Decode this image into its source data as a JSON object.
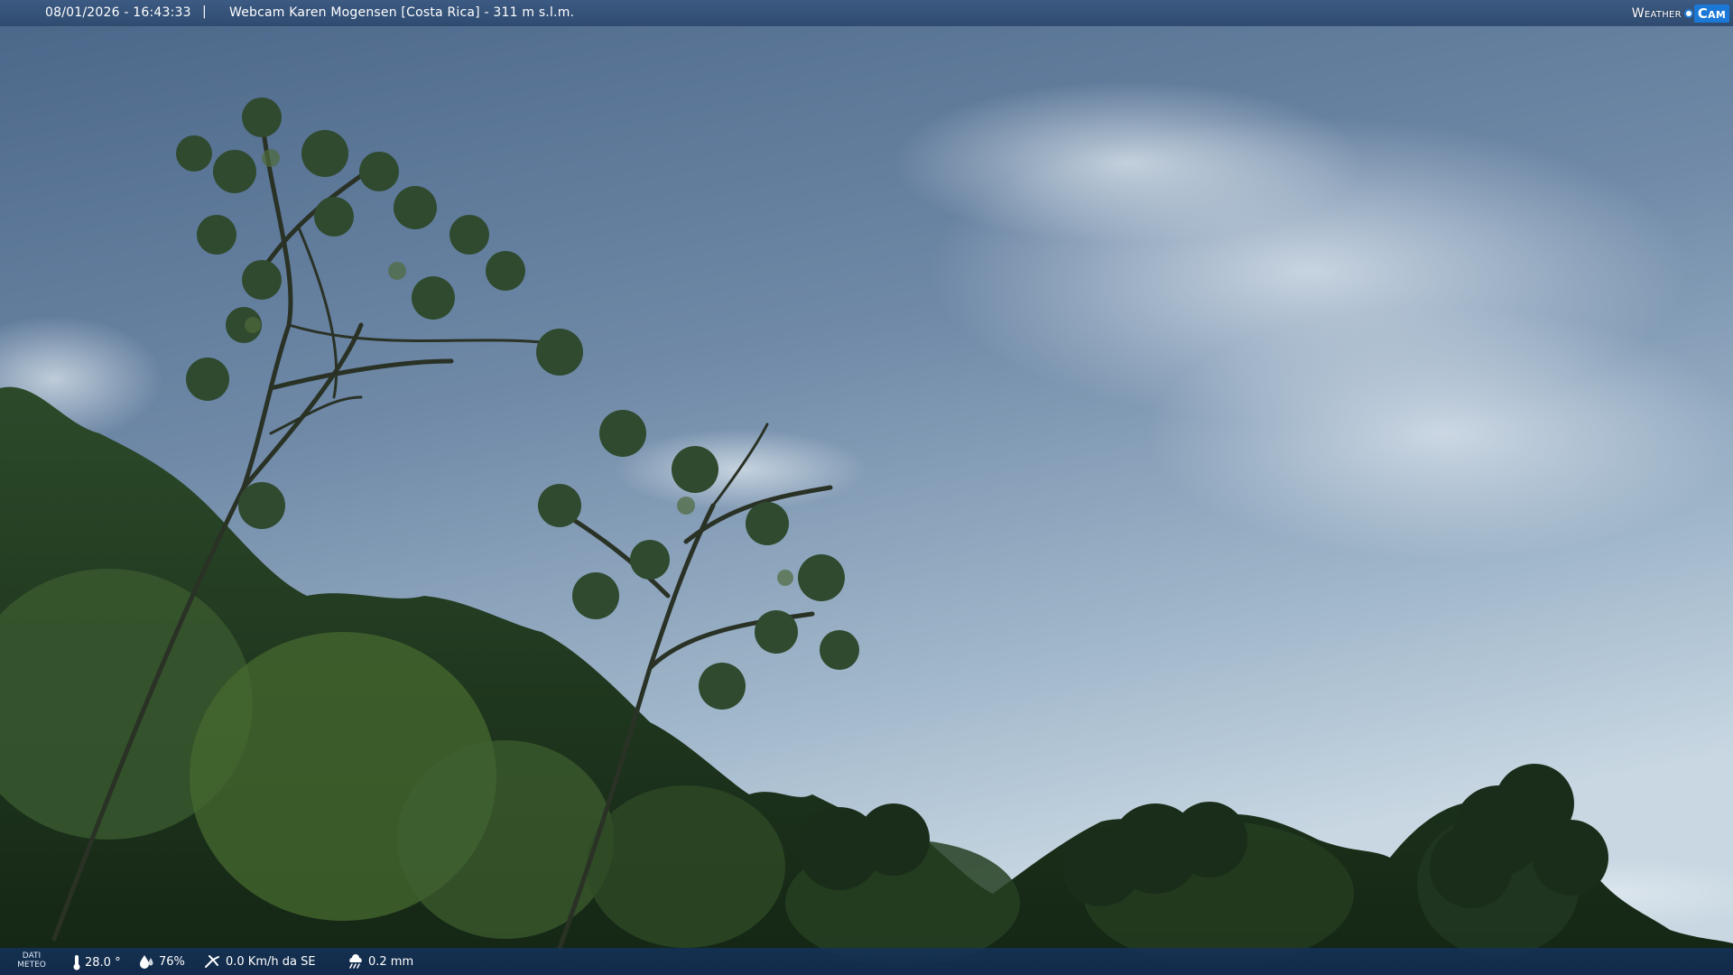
{
  "header": {
    "datetime": "08/01/2026 - 16:43:33",
    "separator": "|",
    "camera_title": "Webcam Karen Mogensen [Costa Rica] - 311 m s.l.m."
  },
  "logo": {
    "weather_text": "Weather",
    "cam_text": "Cam"
  },
  "footer": {
    "meteo_label_line1": "DATI",
    "meteo_label_line2": "METEO",
    "temperature": "28.0 °",
    "humidity": "76%",
    "wind": "0.0 Km/h da SE",
    "rain": "0.2 mm"
  },
  "icons": {
    "temperature": "thermometer-icon",
    "humidity": "humidity-drop-icon",
    "wind": "wind-icon",
    "rain": "rain-cloud-icon"
  },
  "colors": {
    "top_bar": "#34527a",
    "bottom_bar": "#173a66",
    "logo_cam_bg": "#1c78d6",
    "sky_top": "#4a6688",
    "sky_bottom": "#c3d3df"
  }
}
